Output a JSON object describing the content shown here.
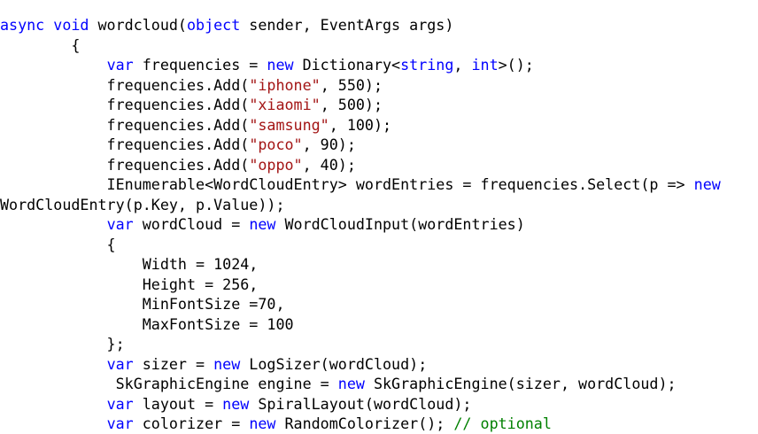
{
  "editor": {
    "language": "C#",
    "colors": {
      "background": "#ffffff",
      "keyword": "#0000ff",
      "string": "#a31515",
      "comment": "#008000",
      "plain": "#000000"
    },
    "lines": [
      [
        {
          "t": "async",
          "c": "kw"
        },
        {
          "t": " ",
          "c": "pl"
        },
        {
          "t": "void",
          "c": "kw"
        },
        {
          "t": " wordcloud(",
          "c": "pl"
        },
        {
          "t": "object",
          "c": "kw"
        },
        {
          "t": " sender, EventArgs args)",
          "c": "pl"
        }
      ],
      [
        {
          "t": "        {",
          "c": "pl"
        }
      ],
      [
        {
          "t": "            ",
          "c": "pl"
        },
        {
          "t": "var",
          "c": "kw"
        },
        {
          "t": " frequencies = ",
          "c": "pl"
        },
        {
          "t": "new",
          "c": "kw"
        },
        {
          "t": " Dictionary<",
          "c": "pl"
        },
        {
          "t": "string",
          "c": "kw"
        },
        {
          "t": ", ",
          "c": "pl"
        },
        {
          "t": "int",
          "c": "kw"
        },
        {
          "t": ">();",
          "c": "pl"
        }
      ],
      [
        {
          "t": "            frequencies.Add(",
          "c": "pl"
        },
        {
          "t": "\"iphone\"",
          "c": "str"
        },
        {
          "t": ", 550);",
          "c": "pl"
        }
      ],
      [
        {
          "t": "            frequencies.Add(",
          "c": "pl"
        },
        {
          "t": "\"xiaomi\"",
          "c": "str"
        },
        {
          "t": ", 500);",
          "c": "pl"
        }
      ],
      [
        {
          "t": "            frequencies.Add(",
          "c": "pl"
        },
        {
          "t": "\"samsung\"",
          "c": "str"
        },
        {
          "t": ", 100);",
          "c": "pl"
        }
      ],
      [
        {
          "t": "            frequencies.Add(",
          "c": "pl"
        },
        {
          "t": "\"poco\"",
          "c": "str"
        },
        {
          "t": ", 90);",
          "c": "pl"
        }
      ],
      [
        {
          "t": "            frequencies.Add(",
          "c": "pl"
        },
        {
          "t": "\"oppo\"",
          "c": "str"
        },
        {
          "t": ", 40);",
          "c": "pl"
        }
      ],
      [
        {
          "t": "            IEnumerable<WordCloudEntry> wordEntries = frequencies.Select(p => ",
          "c": "pl"
        },
        {
          "t": "new",
          "c": "kw"
        }
      ],
      [
        {
          "t": "WordCloudEntry(p.Key, p.Value));",
          "c": "pl"
        }
      ],
      [
        {
          "t": "            ",
          "c": "pl"
        },
        {
          "t": "var",
          "c": "kw"
        },
        {
          "t": " wordCloud = ",
          "c": "pl"
        },
        {
          "t": "new",
          "c": "kw"
        },
        {
          "t": " WordCloudInput(wordEntries)",
          "c": "pl"
        }
      ],
      [
        {
          "t": "            {",
          "c": "pl"
        }
      ],
      [
        {
          "t": "                Width = 1024,",
          "c": "pl"
        }
      ],
      [
        {
          "t": "                Height = 256,",
          "c": "pl"
        }
      ],
      [
        {
          "t": "                MinFontSize =70,",
          "c": "pl"
        }
      ],
      [
        {
          "t": "                MaxFontSize = 100",
          "c": "pl"
        }
      ],
      [
        {
          "t": "            };",
          "c": "pl"
        }
      ],
      [
        {
          "t": "            ",
          "c": "pl"
        },
        {
          "t": "var",
          "c": "kw"
        },
        {
          "t": " sizer = ",
          "c": "pl"
        },
        {
          "t": "new",
          "c": "kw"
        },
        {
          "t": " LogSizer(wordCloud);",
          "c": "pl"
        }
      ],
      [
        {
          "t": "             SkGraphicEngine engine = ",
          "c": "pl"
        },
        {
          "t": "new",
          "c": "kw"
        },
        {
          "t": " SkGraphicEngine(sizer, wordCloud);",
          "c": "pl"
        }
      ],
      [
        {
          "t": "            ",
          "c": "pl"
        },
        {
          "t": "var",
          "c": "kw"
        },
        {
          "t": " layout = ",
          "c": "pl"
        },
        {
          "t": "new",
          "c": "kw"
        },
        {
          "t": " SpiralLayout(wordCloud);",
          "c": "pl"
        }
      ],
      [
        {
          "t": "            ",
          "c": "pl"
        },
        {
          "t": "var",
          "c": "kw"
        },
        {
          "t": " colorizer = ",
          "c": "pl"
        },
        {
          "t": "new",
          "c": "kw"
        },
        {
          "t": " RandomColorizer(); ",
          "c": "pl"
        },
        {
          "t": "// optional",
          "c": "cm"
        }
      ]
    ]
  }
}
